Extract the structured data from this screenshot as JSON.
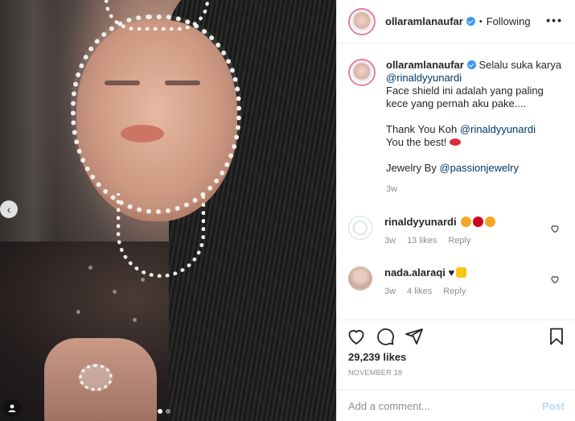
{
  "post": {
    "username": "ollaramlanaufar",
    "follow_sep": "•",
    "follow_label": "Following",
    "more_label": "•••"
  },
  "caption": {
    "username": "ollaramlanaufar",
    "line1": "Selalu suka karya",
    "mention1": "@rinaldyyunardi",
    "line2": "Face shield ini adalah yang paling kece yang pernah aku pake....",
    "line3_prefix": "Thank You Koh",
    "mention2": "@rinaldyyunardi",
    "line4": "You the best!",
    "line5_prefix": "Jewelry By",
    "mention3": "@passionjewelry",
    "time": "3w"
  },
  "comments": [
    {
      "username": "rinaldyyunardi",
      "time": "3w",
      "likes": "13 likes",
      "reply": "Reply",
      "emoji_colors": [
        "#f5a623",
        "#d0021b",
        "#f5a623"
      ]
    },
    {
      "username": "nada.alaraqi",
      "text": "♥",
      "time": "3w",
      "likes": "4 likes",
      "reply": "Reply",
      "emoji_colors": [
        "#f5c518"
      ]
    }
  ],
  "likes_count": "29,239 likes",
  "date": "NOVEMBER 18",
  "add_comment": {
    "placeholder": "Add a comment...",
    "post_label": "Post"
  },
  "nav": {
    "prev_arrow": "‹"
  },
  "colors": {
    "accent_blue": "#3897f0",
    "mention": "#00376b",
    "muted": "#8e8e8e",
    "post_disabled": "#b2dffc",
    "story_ring": "#e27fa2"
  }
}
